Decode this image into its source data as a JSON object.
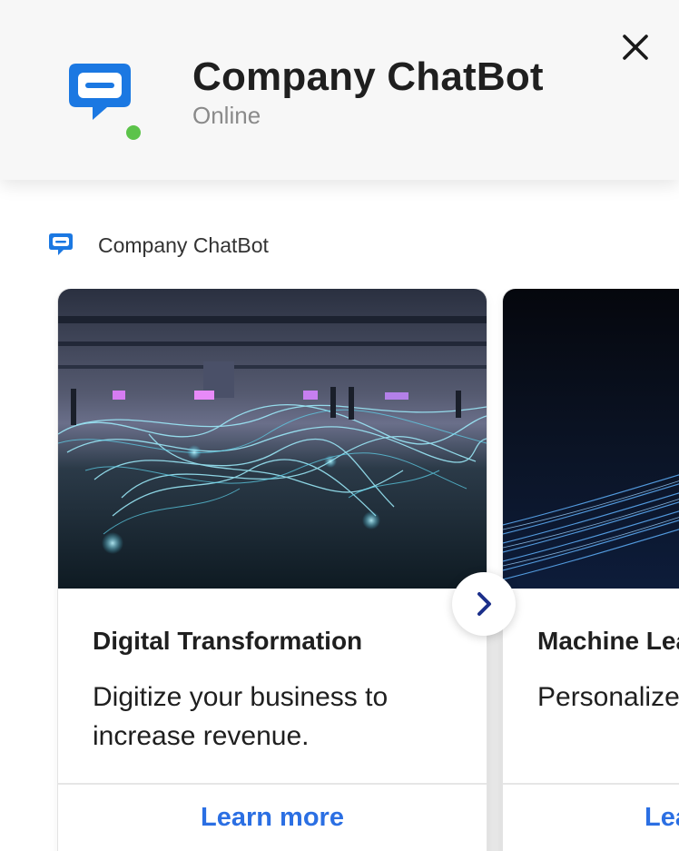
{
  "header": {
    "title": "Company ChatBot",
    "status": "Online",
    "logo_icon": "chat-bubble-icon",
    "close_icon": "close-icon",
    "status_color": "#5cc34a",
    "brand_color": "#1b78e2"
  },
  "message": {
    "sender_name": "Company ChatBot",
    "sender_icon": "chat-bubble-icon"
  },
  "carousel": {
    "next_icon": "chevron-right-icon",
    "cards": [
      {
        "title": "Digital Transformation",
        "description": "Digitize your business to increase revenue.",
        "button_label": "Learn more"
      },
      {
        "title": "Machine Lea",
        "description": "Personalize experience.",
        "button_label": "Lea"
      }
    ]
  }
}
